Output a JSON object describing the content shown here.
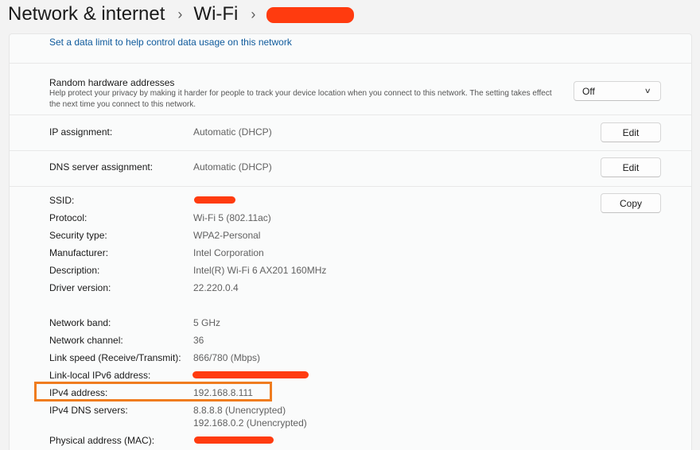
{
  "breadcrumb": {
    "items": [
      "Network & internet",
      "Wi-Fi"
    ],
    "separator": "›",
    "network_name_redacted": true
  },
  "data_limit_link": "Set a data limit to help control data usage on this network",
  "random_hw": {
    "title": "Random hardware addresses",
    "description": "Help protect your privacy by making it harder for people to track your device location when you connect to this network. The setting takes effect the next time you connect to this network.",
    "value": "Off"
  },
  "ip_assignment": {
    "label": "IP assignment:",
    "value": "Automatic (DHCP)",
    "button": "Edit"
  },
  "dns_assignment": {
    "label": "DNS server assignment:",
    "value": "Automatic (DHCP)",
    "button": "Edit"
  },
  "copy_button": "Copy",
  "properties": {
    "ssid": {
      "label": "SSID:",
      "redacted": true
    },
    "protocol": {
      "label": "Protocol:",
      "value": "Wi-Fi 5 (802.11ac)"
    },
    "security": {
      "label": "Security type:",
      "value": "WPA2-Personal"
    },
    "manufacturer": {
      "label": "Manufacturer:",
      "value": "Intel Corporation"
    },
    "description": {
      "label": "Description:",
      "value": "Intel(R) Wi-Fi 6 AX201 160MHz"
    },
    "driver": {
      "label": "Driver version:",
      "value": "22.220.0.4"
    },
    "band": {
      "label": "Network band:",
      "value": "5 GHz"
    },
    "channel": {
      "label": "Network channel:",
      "value": "36"
    },
    "link_speed": {
      "label": "Link speed (Receive/Transmit):",
      "value": "866/780 (Mbps)"
    },
    "ipv6": {
      "label": "Link-local IPv6 address:",
      "redacted": true
    },
    "ipv4": {
      "label": "IPv4 address:",
      "value": "192.168.8.111",
      "highlighted": true
    },
    "ipv4_dns": {
      "label": "IPv4 DNS servers:",
      "values": [
        "8.8.8.8 (Unencrypted)",
        "192.168.0.2 (Unencrypted)"
      ]
    },
    "mac": {
      "label": "Physical address (MAC):",
      "redacted": true
    }
  },
  "colors": {
    "accent_link": "#0e5a9c",
    "redaction": "#ff3b0f",
    "highlight_box": "#ef7c1f"
  }
}
